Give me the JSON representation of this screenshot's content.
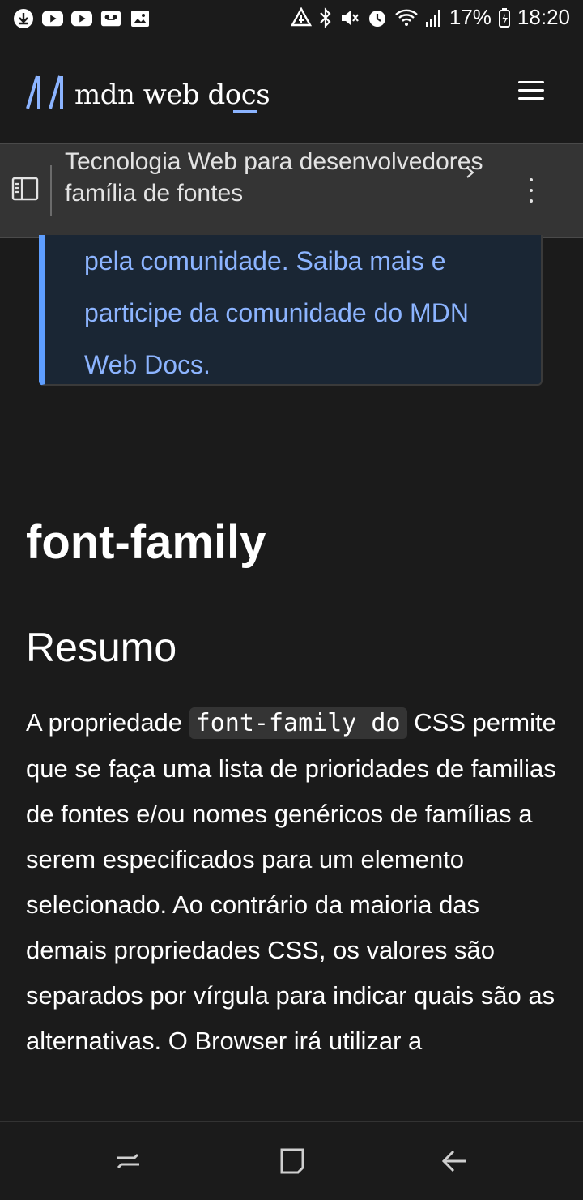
{
  "status_bar": {
    "battery": "17%",
    "time": "18:20"
  },
  "header": {
    "logo_text": "mdn web docs"
  },
  "breadcrumb": {
    "items": [
      "Tecnologia Web para desenvolvedores",
      "família de fontes"
    ]
  },
  "notecard": {
    "text": "pela comunidade. Saiba mais e participe da comunidade do MDN Web Docs."
  },
  "article": {
    "title": "font-family",
    "section_heading": "Resumo",
    "para_before_code": "A propriedade ",
    "code": "font-family do",
    "para_after_code": " CSS permite que se faça uma lista de prioridades de familias de fontes e/ou nomes genéricos de famílias a serem especificados para um elemento selecionado. Ao contrário da maioria das demais propriedades CSS, os valores são separados por vírgula para indicar quais são as alternativas. O Browser irá utilizar a"
  },
  "colors": {
    "accent": "#8cb4ff",
    "note_border": "#5e9eff",
    "background": "#1b1b1b"
  }
}
